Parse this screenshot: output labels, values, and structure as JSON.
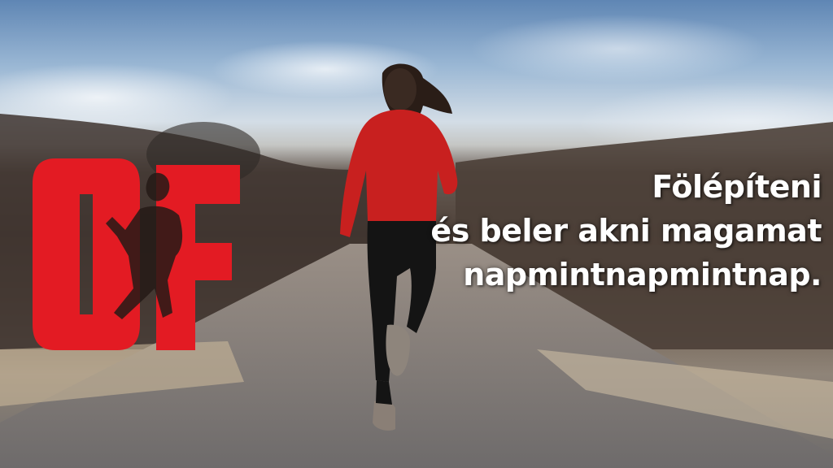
{
  "photo": {
    "subject": "woman-running-on-road",
    "colors": {
      "jacket": "#c8201f",
      "logo": "#e31b23",
      "sky": "#8fb0d2"
    }
  },
  "logo": {
    "letters": "OF",
    "color": "#e31b23"
  },
  "tagline": {
    "line1": "Fölépíteni",
    "line2": "és beler akni magamat",
    "line3": "napmintnapmintnap."
  }
}
